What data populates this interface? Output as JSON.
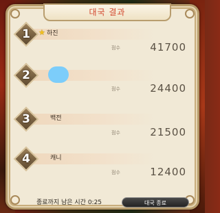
{
  "window": {
    "title": "대국 결과"
  },
  "results": [
    {
      "rank": "1",
      "name": "하진",
      "has_star": true,
      "score_label": "점수",
      "score": "41700"
    },
    {
      "rank": "2",
      "name": "",
      "has_avatar_blob": true,
      "score_label": "점수",
      "score": "24400"
    },
    {
      "rank": "3",
      "name": "백전",
      "score_label": "점수",
      "score": "21500"
    },
    {
      "rank": "4",
      "name": "캐니",
      "score_label": "점수",
      "score": "12400"
    }
  ],
  "footer": {
    "time_remaining_text": "종료까지 남은 시간 0:25",
    "end_button_label": "대국 종료"
  },
  "colors": {
    "title": "#d2482e",
    "star": "#f2c01e",
    "avatar_blob": "#7ccdfa",
    "panel": "#f1e9d6"
  }
}
